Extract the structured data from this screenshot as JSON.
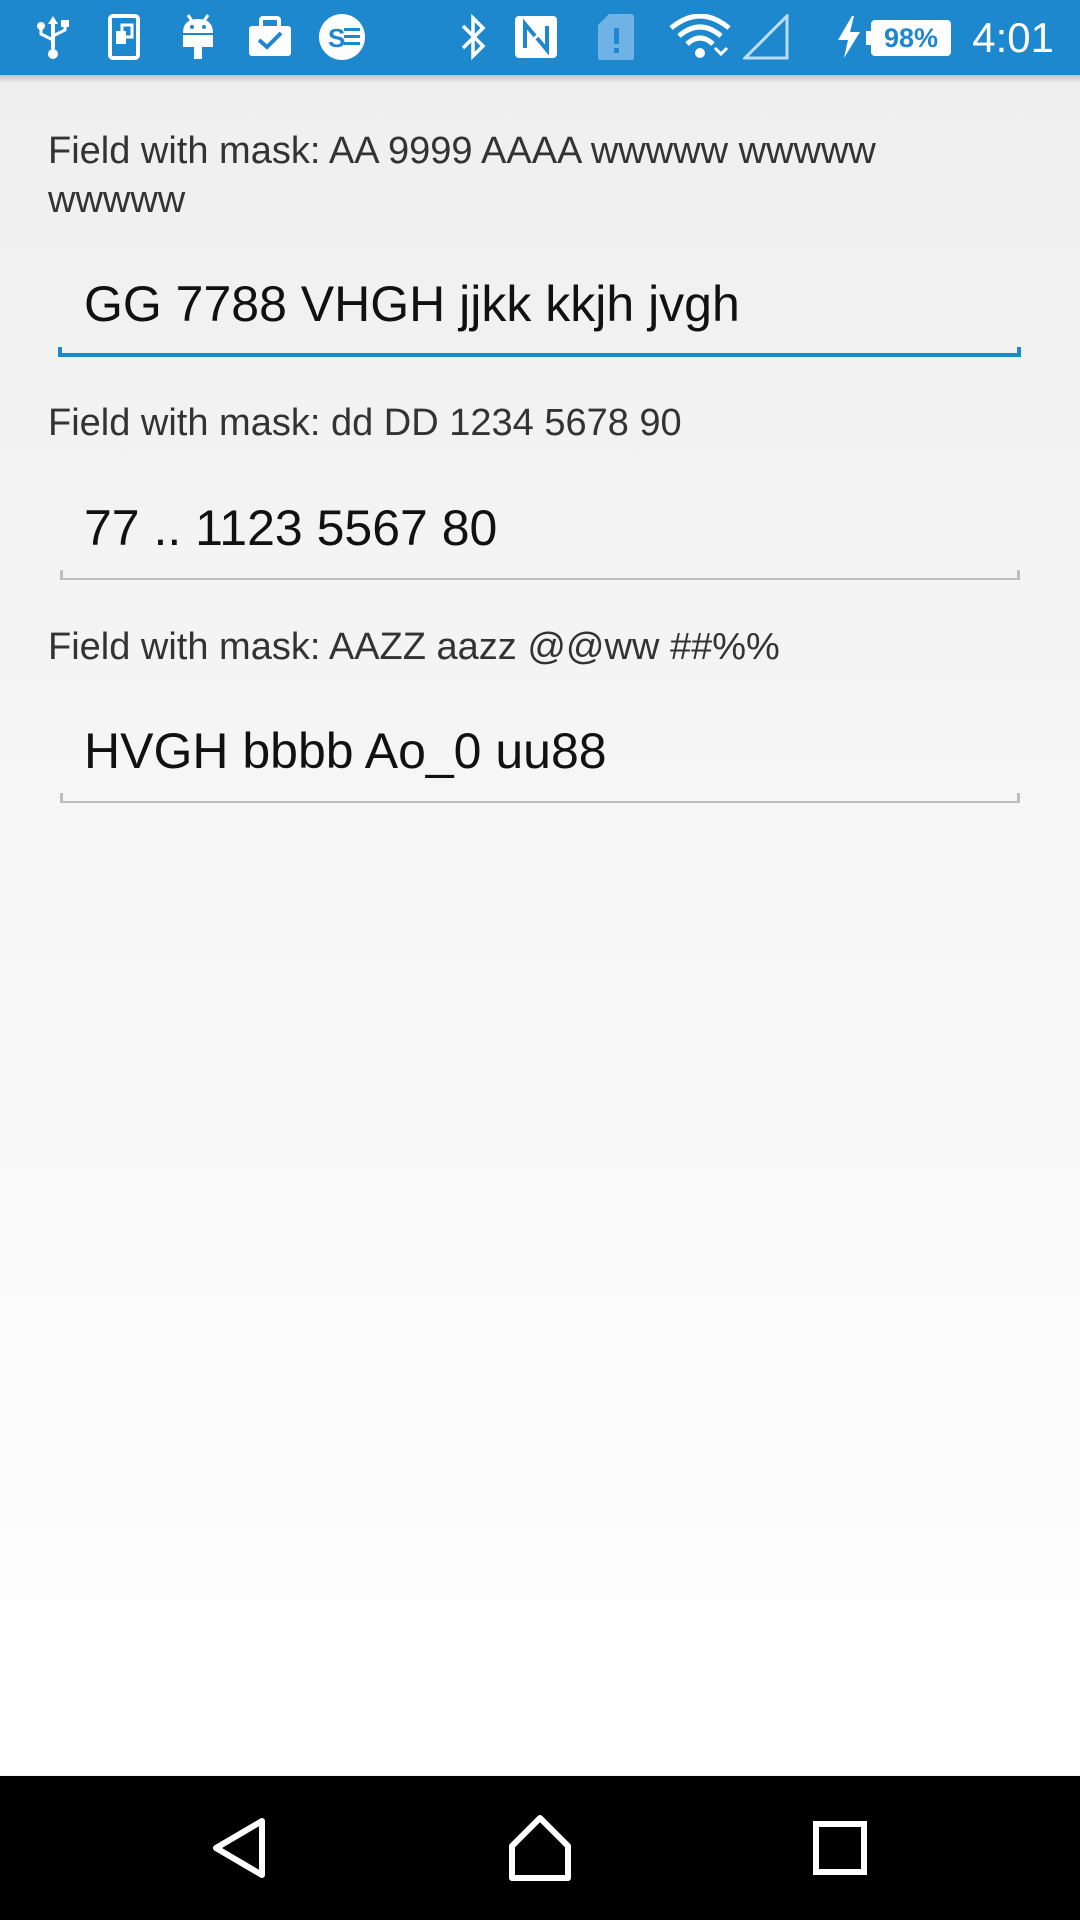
{
  "status_bar": {
    "icons": [
      "usb-icon",
      "sim-manager-icon",
      "android-icon",
      "clipboard-check-icon",
      "stamina-icon",
      "bluetooth-icon",
      "nfc-icon",
      "sd-card-alert-icon",
      "wifi-icon",
      "cellular-signal-icon",
      "charging-icon"
    ],
    "battery_percent": "98%",
    "time": "4:01",
    "color": "#1e88cf"
  },
  "fields": [
    {
      "label": "Field with mask: AA 9999 AAAA wwwww wwwww wwwww",
      "value": "GG 7788 VHGH jjkk kkjh jvgh",
      "focused": true
    },
    {
      "label": "Field with mask: dd DD 1234 5678 90",
      "value": "77 .. 1123 5567 80",
      "focused": false
    },
    {
      "label": "Field with mask: AAZZ aazz @@ww ##%%",
      "value": "HVGH bbbb Ao_0 uu88",
      "focused": false
    }
  ],
  "nav_bar": {
    "buttons": [
      "back-icon",
      "home-icon",
      "recents-icon"
    ]
  },
  "colors": {
    "accent": "#1e88cf",
    "underline": "#bdbdbd",
    "text": "#333333"
  }
}
